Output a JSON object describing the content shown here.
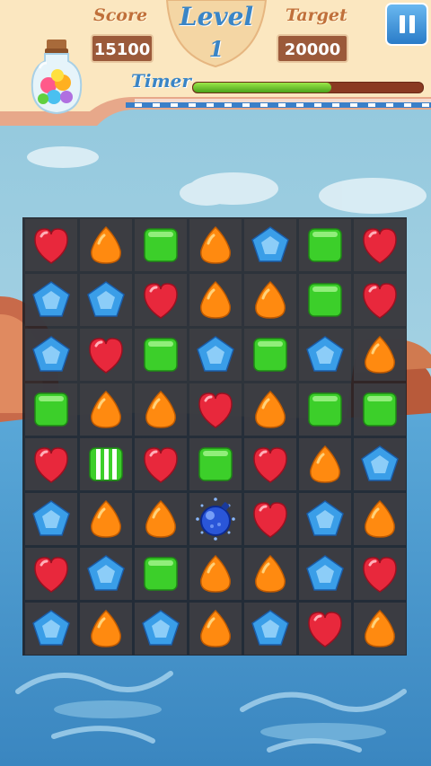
{
  "hud": {
    "score_label": "Score",
    "score_value": "15100",
    "level_label": "Level",
    "level_value": "1",
    "target_label": "Target",
    "target_value": "20000",
    "timer_label": "Timer",
    "timer_fraction": 0.6
  },
  "board": {
    "rows": 8,
    "cols": 7,
    "grid": [
      [
        "red-heart",
        "orange-drop",
        "green-square",
        "orange-drop",
        "blue-pentagon",
        "green-square",
        "red-heart"
      ],
      [
        "blue-pentagon",
        "blue-pentagon",
        "red-heart",
        "orange-drop",
        "orange-drop",
        "green-square",
        "red-heart"
      ],
      [
        "blue-pentagon",
        "red-heart",
        "green-square",
        "blue-pentagon",
        "green-square",
        "blue-pentagon",
        "orange-drop"
      ],
      [
        "green-square",
        "orange-drop",
        "orange-drop",
        "red-heart",
        "orange-drop",
        "green-square",
        "green-square"
      ],
      [
        "red-heart",
        "green-striped",
        "red-heart",
        "green-square",
        "red-heart",
        "orange-drop",
        "blue-pentagon"
      ],
      [
        "blue-pentagon",
        "orange-drop",
        "orange-drop",
        "blue-bomb",
        "red-heart",
        "blue-pentagon",
        "orange-drop"
      ],
      [
        "red-heart",
        "blue-pentagon",
        "green-square",
        "orange-drop",
        "orange-drop",
        "blue-pentagon",
        "red-heart"
      ],
      [
        "blue-pentagon",
        "orange-drop",
        "blue-pentagon",
        "orange-drop",
        "blue-pentagon",
        "red-heart",
        "orange-drop"
      ]
    ]
  },
  "colors": {
    "red": "#e8283c",
    "orange": "#ff8a10",
    "green": "#3ccf2a",
    "blue": "#3a9ee8",
    "hud_brown": "#c0703a",
    "hud_blue": "#3a85c6"
  }
}
